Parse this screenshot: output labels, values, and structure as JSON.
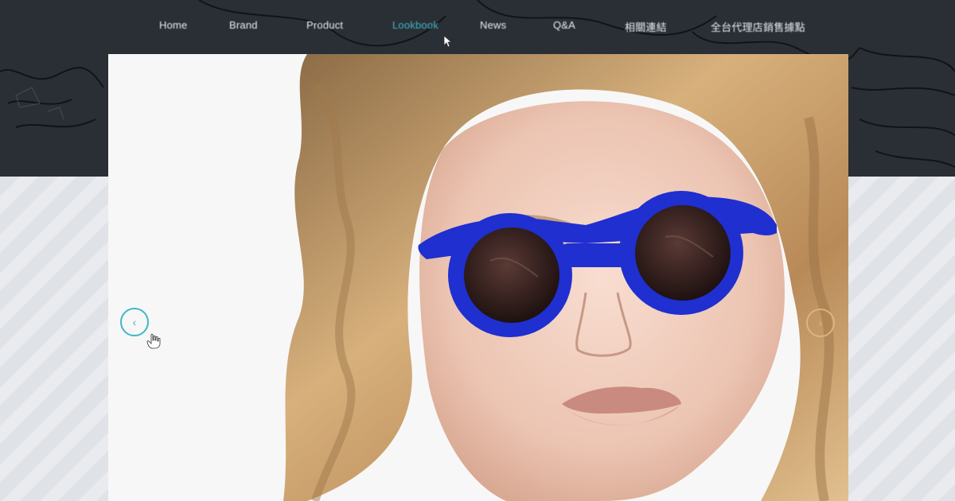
{
  "nav": {
    "items": [
      {
        "label": "Home",
        "active": false
      },
      {
        "label": "Brand",
        "active": false
      },
      {
        "label": "Product",
        "active": false
      },
      {
        "label": "Lookbook",
        "active": true
      },
      {
        "label": "News",
        "active": false
      },
      {
        "label": "Q&A",
        "active": false
      },
      {
        "label": "相關連結",
        "active": false
      },
      {
        "label": "全台代理店銷售據點",
        "active": false
      }
    ]
  },
  "slider": {
    "prev_icon": "chevron-left-icon",
    "next_icon": "chevron-right-icon",
    "image_subject": "model-wearing-blue-round-sunglasses"
  },
  "colors": {
    "header_bg": "#2a2f35",
    "accent": "#3fb7c7",
    "sunglasses_frame": "#1f2fd0"
  }
}
